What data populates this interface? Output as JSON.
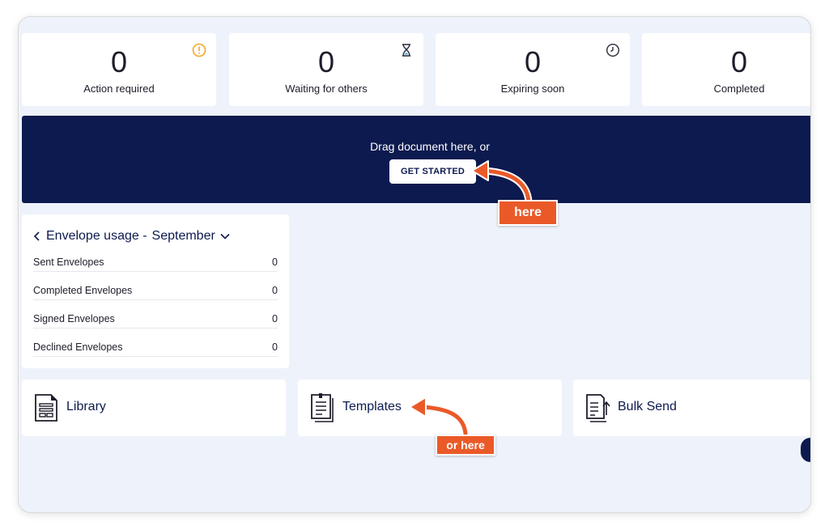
{
  "stats": [
    {
      "value": "0",
      "label": "Action required",
      "icon": "alert-circle-icon"
    },
    {
      "value": "0",
      "label": "Waiting for others",
      "icon": "hourglass-icon"
    },
    {
      "value": "0",
      "label": "Expiring soon",
      "icon": "clock-icon"
    },
    {
      "value": "0",
      "label": "Completed"
    }
  ],
  "banner": {
    "text": "Drag document here, or",
    "button_label": "GET STARTED"
  },
  "usage": {
    "title": "Envelope usage -",
    "month": "September",
    "rows": [
      {
        "label": "Sent Envelopes",
        "value": "0"
      },
      {
        "label": "Completed Envelopes",
        "value": "0"
      },
      {
        "label": "Signed Envelopes",
        "value": "0"
      },
      {
        "label": "Declined Envelopes",
        "value": "0"
      }
    ]
  },
  "tiles": [
    {
      "label": "Library",
      "icon": "library-icon"
    },
    {
      "label": "Templates",
      "icon": "templates-icon"
    },
    {
      "label": "Bulk Send",
      "icon": "bulk-send-icon"
    }
  ],
  "callouts": {
    "here": "here",
    "or_here": "or here"
  },
  "colors": {
    "navy": "#0c1a4f",
    "accent_orange": "#ea5a28",
    "warning": "#f5a623",
    "background": "#eef3fb"
  }
}
